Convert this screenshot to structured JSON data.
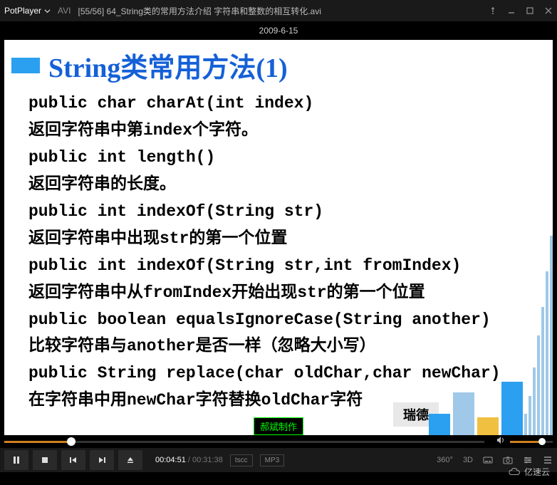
{
  "titlebar": {
    "app_name": "PotPlayer",
    "format": "AVI",
    "file_title": "[55/56] 64_String类的常用方法介绍 字符串和整数的相互转化.avi"
  },
  "date": "2009-6-15",
  "slide": {
    "title": "String类常用方法(1)",
    "lines": [
      "public char charAt(int index)",
      "返回字符串中第index个字符。",
      "public int length()",
      "返回字符串的长度。",
      "public int indexOf(String str)",
      "返回字符串中出现str的第一个位置",
      "public int indexOf(String str,int fromIndex)",
      "返回字符串中从fromIndex开始出现str的第一个位置",
      "public boolean equalsIgnoreCase(String another)",
      "比较字符串与another是否一样（忽略大小写）",
      "public String replace(char oldChar,char newChar)",
      "在字符串中用newChar字符替换oldChar字符"
    ],
    "author_label": "郝斌制作",
    "footer_right": "瑞德"
  },
  "playback": {
    "current_time": "00:04:51",
    "duration": "00:31:38",
    "video_codec": "tscc",
    "audio_codec": "MP3",
    "progress_percent": 14,
    "volume_percent": 75
  },
  "right_controls": {
    "label_360": "360°",
    "label_3d": "3D"
  },
  "watermark": "亿速云"
}
